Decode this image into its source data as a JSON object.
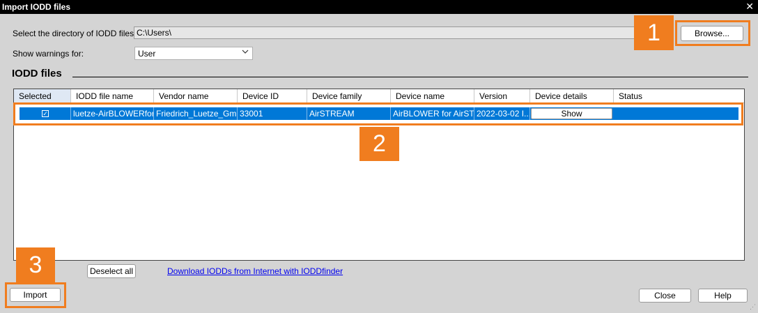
{
  "window": {
    "title": "Import  IODD files",
    "close_glyph": "✕"
  },
  "directory": {
    "label": "Select the directory of IODD files:",
    "value": "C:\\Users\\",
    "browse_label": "Browse..."
  },
  "warnings": {
    "label": "Show warnings for:",
    "value": "User",
    "icon": "chevron-down-icon"
  },
  "section_title": "IODD files",
  "table": {
    "columns": [
      "Selected",
      "IODD file name",
      "Vendor name",
      "Device ID",
      "Device family",
      "Device name",
      "Version",
      "Device details",
      "Status"
    ],
    "rows": [
      {
        "selected": true,
        "file_name": "luetze-AirBLOWERfor...",
        "vendor": "Friedrich_Luetze_Gm...",
        "device_id": "33001",
        "family": "AirSTREAM",
        "device_name": "AirBLOWER for AirST...",
        "version": "2022-03-02 I...",
        "details_button": "Show",
        "status": ""
      }
    ]
  },
  "footer": {
    "deselect_label": "Deselect all",
    "link_label": "Download IODDs from Internet with IODDfinder",
    "import_label": "Import",
    "close_label": "Close",
    "help_label": "Help"
  },
  "annotations": [
    "1",
    "2",
    "3"
  ],
  "colors": {
    "accent_orange": "#f07d1f",
    "selection_blue": "#0078d7"
  }
}
